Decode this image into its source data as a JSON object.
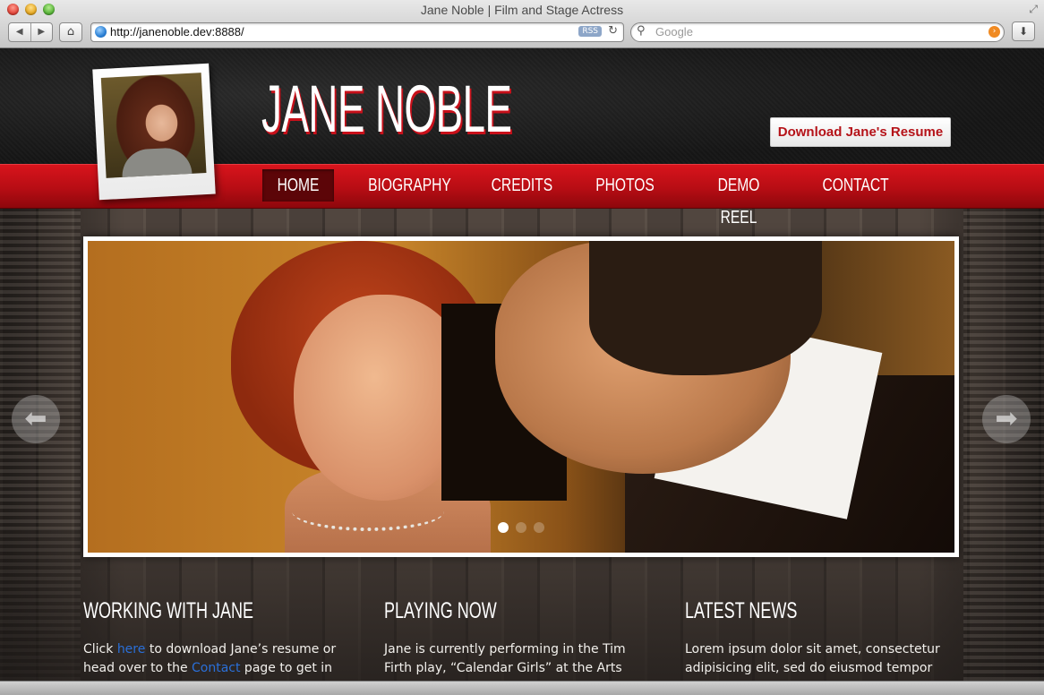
{
  "browser": {
    "window_title": "Jane Noble | Film and Stage Actress",
    "url": "http://janenoble.dev:8888/",
    "rss_label": "RSS",
    "search_placeholder": "Google"
  },
  "site": {
    "title": "JANE NOBLE",
    "resume_button": "Download Jane's Resume",
    "nav": [
      {
        "label": "HOME",
        "active": true
      },
      {
        "label": "BIOGRAPHY",
        "active": false
      },
      {
        "label": "CREDITS",
        "active": false
      },
      {
        "label": "PHOTOS",
        "active": false
      },
      {
        "label": "DEMO REEL",
        "active": false
      },
      {
        "label": "CONTACT",
        "active": false
      }
    ]
  },
  "slider": {
    "slide_count": 3,
    "active_slide": 1
  },
  "columns": [
    {
      "heading": "WORKING WITH JANE",
      "text_1": "Click ",
      "link_1": "here",
      "text_2": " to download Jane’s resume or head over to the ",
      "link_2": "Contact",
      "text_3": " page to get in"
    },
    {
      "heading": "PLAYING NOW",
      "text": "Jane is currently performing in the Tim Firth play, “Calendar Girls” at the Arts Club in"
    },
    {
      "heading": "LATEST NEWS",
      "text": "Lorem ipsum dolor sit amet, consectetur adipisicing elit, sed do eiusmod tempor"
    }
  ],
  "colors": {
    "brand_red": "#c8101a",
    "link_blue": "#2a6fd8"
  }
}
